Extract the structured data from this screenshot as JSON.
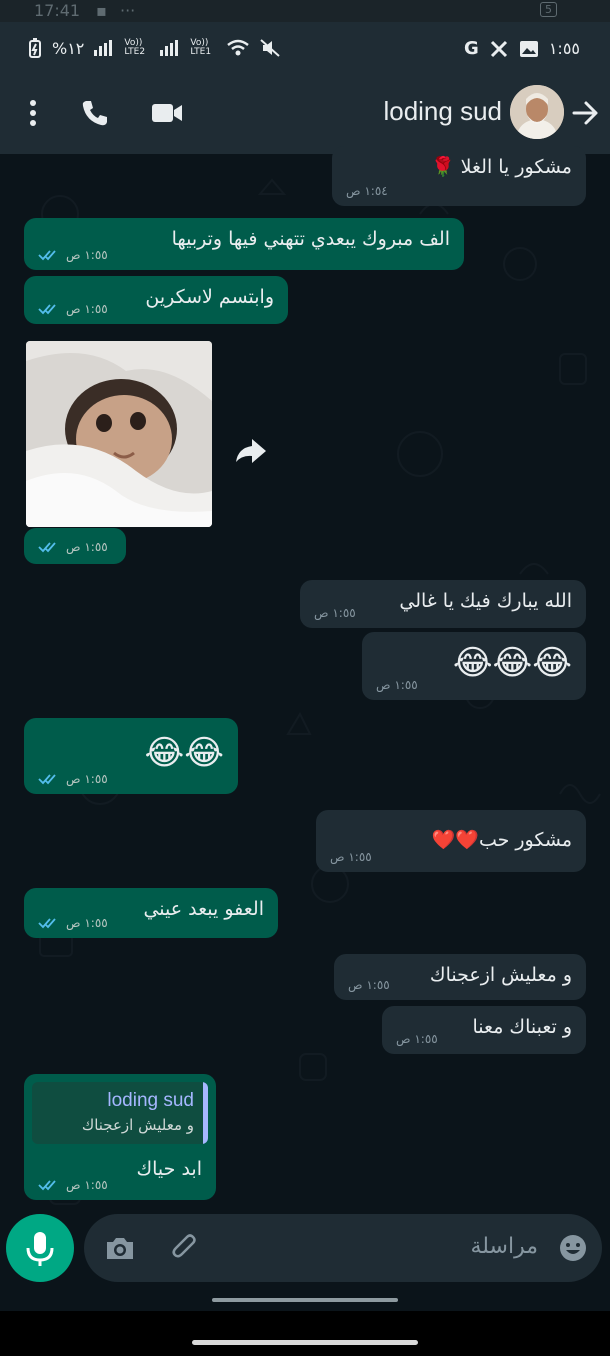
{
  "ghost_status": {
    "time": "17:41",
    "dots": "···",
    "battery": "5"
  },
  "status_bar": {
    "battery_percent": "%١٢",
    "sim1": "Vo)) LTE2",
    "sim2": "Vo)) LTE1",
    "time": "١:٥٥",
    "google_letter": "G"
  },
  "header": {
    "contact_name": "loding sud"
  },
  "messages": [
    {
      "text": "مشكور يا الغلا 🌹",
      "time": "١:٥٤ ص"
    },
    {
      "text": "الف مبروك يبعدي تتهني فيها وتربيها",
      "time": "١:٥٥ ص"
    },
    {
      "text": "وابتسم لاسكرين",
      "time": "١:٥٥ ص"
    },
    {
      "text": "",
      "time": "١:٥٥ ص"
    },
    {
      "text": "الله يبارك فيك يا غالي",
      "time": "١:٥٥ ص"
    },
    {
      "text": "😂😂😂",
      "time": "١:٥٥ ص"
    },
    {
      "text": "😂😂",
      "time": "١:٥٥ ص"
    },
    {
      "text": "مشكور حب❤️❤️",
      "time": "١:٥٥ ص"
    },
    {
      "text": "العفو يبعد عيني",
      "time": "١:٥٥ ص"
    },
    {
      "text": "و معليش ازعجناك",
      "time": "١:٥٥ ص"
    },
    {
      "text": "و تعبناك معنا",
      "time": "١:٥٥ ص"
    },
    {
      "text": "ابد حياك",
      "time": "١:٥٥ ص",
      "reply_name": "loding sud",
      "reply_text": "و معليش ازعجناك"
    }
  ],
  "composer": {
    "placeholder": "مراسلة"
  },
  "icons": {
    "back": "arrow-right-icon",
    "video": "video-call-icon",
    "call": "phone-icon",
    "menu": "more-vert-icon",
    "forward": "forward-icon",
    "emoji": "emoji-icon",
    "attach": "attach-icon",
    "camera": "camera-icon",
    "mic": "mic-icon",
    "read_receipt": "double-check-icon"
  },
  "colors": {
    "header_bg": "#1f2c34",
    "chat_bg": "#0b141a",
    "incoming_bubble": "#1f2c34",
    "outgoing_bubble": "#005c4b",
    "accent": "#00a884",
    "read_tick": "#53bdeb",
    "quote_name": "#a5b7ff"
  }
}
